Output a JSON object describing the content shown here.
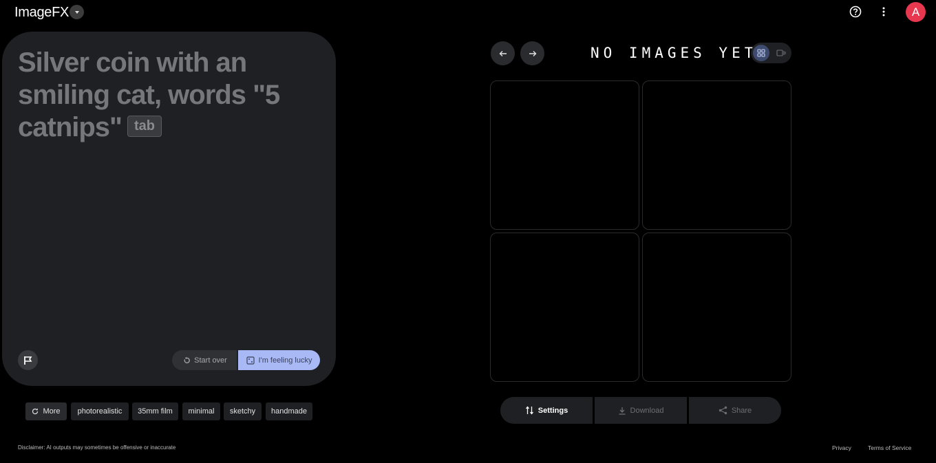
{
  "header": {
    "app_title": "ImageFX",
    "avatar_letter": "A"
  },
  "prompt": {
    "text": "Silver coin with an smiling cat, words \"5 catnips\"",
    "tab_hint": "tab",
    "start_over_label": "Start over",
    "lucky_label": "I'm feeling lucky"
  },
  "chips": {
    "more_label": "More",
    "styles": [
      "photorealistic",
      "35mm film",
      "minimal",
      "sketchy",
      "handmade"
    ]
  },
  "gallery": {
    "empty_title": "NO IMAGES YET"
  },
  "actions": {
    "settings_label": "Settings",
    "download_label": "Download",
    "share_label": "Share"
  },
  "footer": {
    "disclaimer": "Disclaimer: AI outputs may sometimes be offensive or inaccurate",
    "privacy": "Privacy",
    "terms": "Terms of Service"
  },
  "colors": {
    "background": "#000000",
    "panel": "#1f2023",
    "accent": "#a8b9f5",
    "avatar": "#e8384f"
  }
}
